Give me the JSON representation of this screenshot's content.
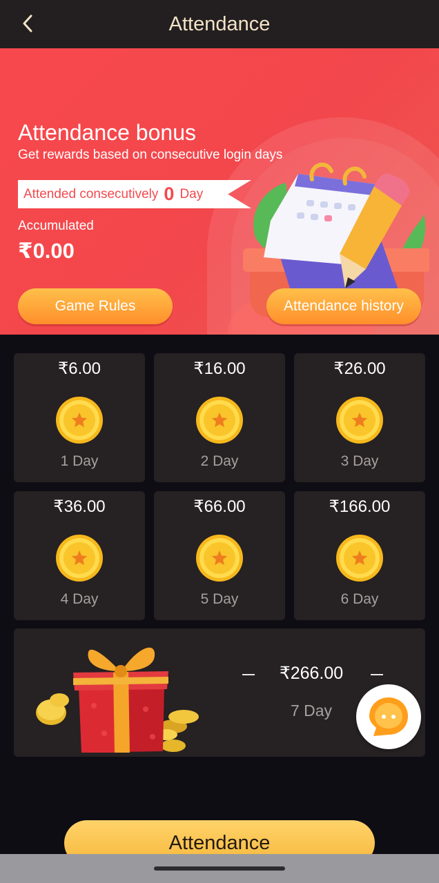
{
  "header": {
    "title": "Attendance",
    "back_icon": "chevron-left-icon"
  },
  "banner": {
    "title": "Attendance bonus",
    "subtitle": "Get rewards based on consecutive login days",
    "streak_prefix": "Attended consecutively",
    "streak_count": "0",
    "streak_suffix": "Day",
    "accumulated_label": "Accumulated",
    "accumulated_value": "₹0.00",
    "rules_button": "Game Rules",
    "history_button": "Attendance history",
    "illustration": "calendar-pencil-icon"
  },
  "rewards": [
    {
      "amount": "₹6.00",
      "day": "1 Day",
      "icon": "coin-star-icon"
    },
    {
      "amount": "₹16.00",
      "day": "2 Day",
      "icon": "coin-star-icon"
    },
    {
      "amount": "₹26.00",
      "day": "3 Day",
      "icon": "coin-star-icon"
    },
    {
      "amount": "₹36.00",
      "day": "4 Day",
      "icon": "coin-star-icon"
    },
    {
      "amount": "₹66.00",
      "day": "5 Day",
      "icon": "coin-star-icon"
    },
    {
      "amount": "₹166.00",
      "day": "6 Day",
      "icon": "coin-star-icon"
    }
  ],
  "final_reward": {
    "amount": "₹266.00",
    "day": "7 Day",
    "icon": "gift-box-icon"
  },
  "chat_icon": "chat-bubble-icon",
  "attendance_button": "Attendance",
  "colors": {
    "header_bg": "#231f20",
    "banner_red": "#f7484d",
    "card_bg": "#262122",
    "gold_button": "#f6b73b",
    "orange_button": "#ff8f2b"
  }
}
